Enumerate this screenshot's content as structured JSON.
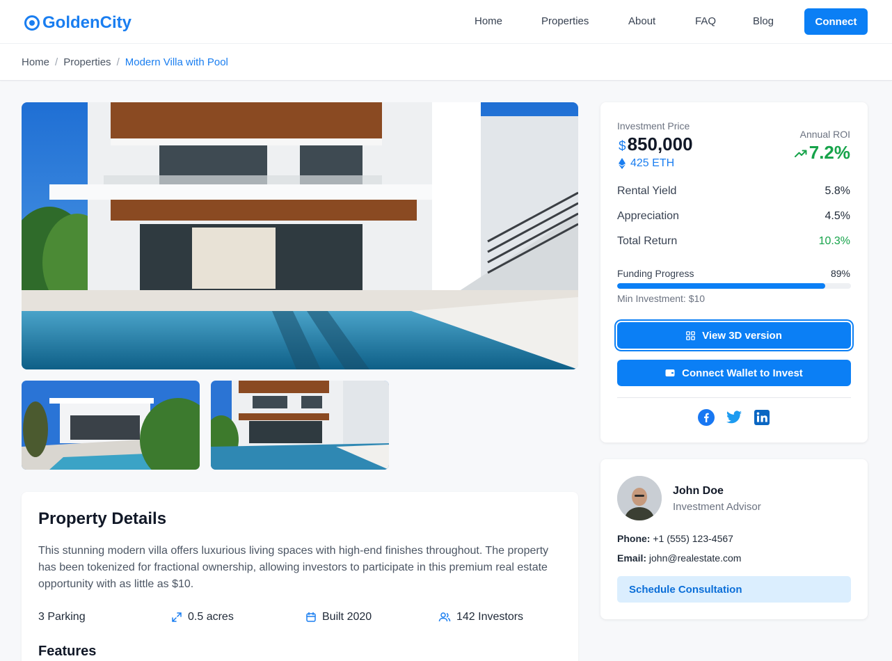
{
  "brand": {
    "name": "GoldenCity",
    "color": "#1a7ef0"
  },
  "nav": {
    "items": [
      "Home",
      "Properties",
      "About",
      "FAQ",
      "Blog"
    ],
    "connect_label": "Connect"
  },
  "breadcrumb": {
    "items": [
      "Home",
      "Properties"
    ],
    "current": "Modern Villa with Pool"
  },
  "gallery": {
    "main_alt": "Modern villa with pool",
    "thumbs": [
      "Villa exterior side view",
      "Villa pool front view"
    ]
  },
  "details": {
    "title": "Property Details",
    "description": "This stunning modern villa offers luxurious living spaces with high-end finishes throughout. The property has been tokenized for fractional ownership, allowing investors to participate in this premium real estate opportunity with as little as $10.",
    "facts": {
      "parking": "3 Parking",
      "area": "0.5 acres",
      "built": "Built 2020",
      "investors": "142 Investors"
    },
    "features_title": "Features"
  },
  "investment": {
    "price_label": "Investment Price",
    "currency_symbol": "$",
    "price": "$850,000",
    "eth": "425 ETH",
    "roi_label": "Annual ROI",
    "roi": "7.2%",
    "metrics": [
      {
        "label": "Rental Yield",
        "value": "5.8%"
      },
      {
        "label": "Appreciation",
        "value": "4.5%"
      },
      {
        "label": "Total Return",
        "value": "10.3%"
      }
    ],
    "funding_label": "Funding Progress",
    "funding_text": "89%",
    "funding_fraction": 0.89,
    "min_investment": "Min Investment: $10",
    "view_3d_label": "View 3D version",
    "wallet_label": "Connect Wallet to Invest",
    "social_icons": [
      "facebook-icon",
      "twitter-icon",
      "linkedin-icon"
    ]
  },
  "advisor": {
    "name": "John Doe",
    "role": "Investment Advisor",
    "phone_label": "Phone:",
    "phone": "+1 (555) 123-4567",
    "email_label": "Email:",
    "email": "john@realestate.com",
    "schedule_label": "Schedule Consultation"
  },
  "colors": {
    "accent": "#0b7ff5",
    "positive": "#16a34a",
    "soft_accent": "#dbeefe"
  }
}
